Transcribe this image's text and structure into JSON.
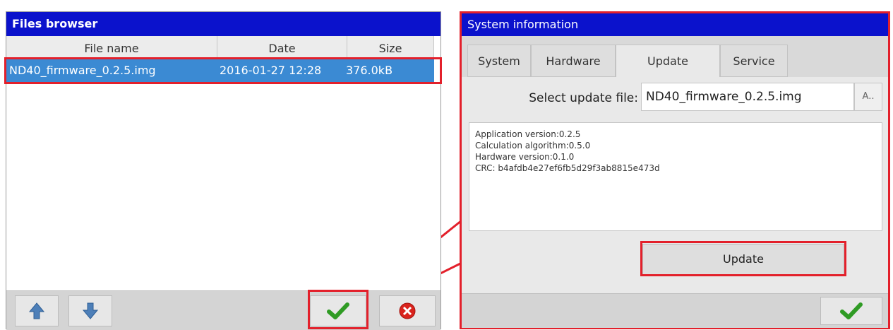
{
  "files_browser": {
    "title": "Files browser",
    "columns": [
      "File name",
      "Date",
      "Size"
    ],
    "rows": [
      {
        "name": "ND40_firmware_0.2.5.img",
        "date": "2016-01-27 12:28",
        "size": "376.0kB"
      }
    ]
  },
  "system_info": {
    "title": "System information",
    "tabs": [
      "System",
      "Hardware",
      "Update",
      "Service"
    ],
    "active_tab": "Update",
    "select_label": "Select update file:",
    "select_value": "ND40_firmware_0.2.5.img",
    "browse_label": "A..",
    "info_lines": [
      "Application version:0.2.5",
      "Calculation algorithm:0.5.0",
      "Hardware version:0.1.0",
      "CRC: b4afdb4e27ef6fb5d29f3ab8815e473d"
    ],
    "update_label": "Update"
  },
  "colors": {
    "titlebar": "#0b12cc",
    "selection": "#3b8ad3",
    "highlight": "#e3202b",
    "ok_check": "#2f9b24",
    "cancel": "#d9231d"
  },
  "icons": [
    "arrow-up-icon",
    "arrow-down-icon",
    "check-icon",
    "cancel-icon"
  ]
}
